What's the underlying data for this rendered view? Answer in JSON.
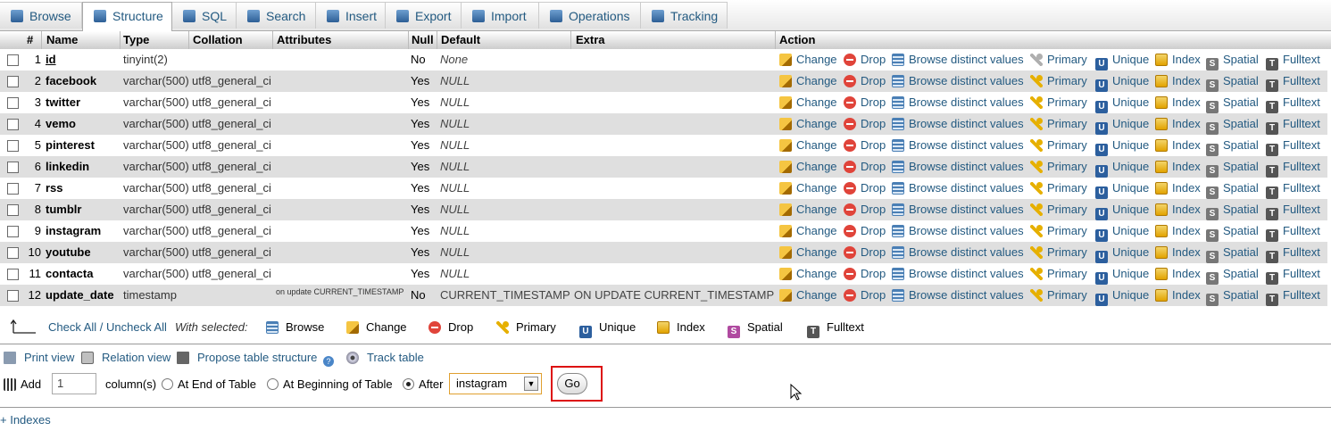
{
  "tabs": [
    {
      "label": "Browse",
      "icon": "browse-icon"
    },
    {
      "label": "Structure",
      "icon": "structure-icon"
    },
    {
      "label": "SQL",
      "icon": "sql-icon"
    },
    {
      "label": "Search",
      "icon": "search-icon"
    },
    {
      "label": "Insert",
      "icon": "insert-icon"
    },
    {
      "label": "Export",
      "icon": "export-icon"
    },
    {
      "label": "Import",
      "icon": "import-icon"
    },
    {
      "label": "Operations",
      "icon": "wrench-icon"
    },
    {
      "label": "Tracking",
      "icon": "eye-icon"
    }
  ],
  "active_tab": "Structure",
  "columns": {
    "num": "#",
    "name": "Name",
    "type": "Type",
    "collation": "Collation",
    "attributes": "Attributes",
    "null": "Null",
    "default": "Default",
    "extra": "Extra",
    "action": "Action"
  },
  "rows": [
    {
      "num": "1",
      "name": "id",
      "type": "tinyint(2)",
      "collation": "",
      "attributes": "",
      "null": "No",
      "default": "None",
      "extra": ""
    },
    {
      "num": "2",
      "name": "facebook",
      "type": "varchar(500)",
      "collation": "utf8_general_ci",
      "attributes": "",
      "null": "Yes",
      "default": "NULL",
      "extra": ""
    },
    {
      "num": "3",
      "name": "twitter",
      "type": "varchar(500)",
      "collation": "utf8_general_ci",
      "attributes": "",
      "null": "Yes",
      "default": "NULL",
      "extra": ""
    },
    {
      "num": "4",
      "name": "vemo",
      "type": "varchar(500)",
      "collation": "utf8_general_ci",
      "attributes": "",
      "null": "Yes",
      "default": "NULL",
      "extra": ""
    },
    {
      "num": "5",
      "name": "pinterest",
      "type": "varchar(500)",
      "collation": "utf8_general_ci",
      "attributes": "",
      "null": "Yes",
      "default": "NULL",
      "extra": ""
    },
    {
      "num": "6",
      "name": "linkedin",
      "type": "varchar(500)",
      "collation": "utf8_general_ci",
      "attributes": "",
      "null": "Yes",
      "default": "NULL",
      "extra": ""
    },
    {
      "num": "7",
      "name": "rss",
      "type": "varchar(500)",
      "collation": "utf8_general_ci",
      "attributes": "",
      "null": "Yes",
      "default": "NULL",
      "extra": ""
    },
    {
      "num": "8",
      "name": "tumblr",
      "type": "varchar(500)",
      "collation": "utf8_general_ci",
      "attributes": "",
      "null": "Yes",
      "default": "NULL",
      "extra": ""
    },
    {
      "num": "9",
      "name": "instagram",
      "type": "varchar(500)",
      "collation": "utf8_general_ci",
      "attributes": "",
      "null": "Yes",
      "default": "NULL",
      "extra": ""
    },
    {
      "num": "10",
      "name": "youtube",
      "type": "varchar(500)",
      "collation": "utf8_general_ci",
      "attributes": "",
      "null": "Yes",
      "default": "NULL",
      "extra": ""
    },
    {
      "num": "11",
      "name": "contacta",
      "type": "varchar(500)",
      "collation": "utf8_general_ci",
      "attributes": "",
      "null": "Yes",
      "default": "NULL",
      "extra": ""
    },
    {
      "num": "12",
      "name": "update_date",
      "type": "timestamp",
      "collation": "",
      "attributes": "on update CURRENT_TIMESTAMP",
      "null": "No",
      "default": "CURRENT_TIMESTAMP",
      "extra": "ON UPDATE CURRENT_TIMESTAMP"
    }
  ],
  "row_actions": {
    "change": "Change",
    "drop": "Drop",
    "browse_distinct": "Browse distinct values",
    "primary": "Primary",
    "unique": "Unique",
    "index": "Index",
    "spatial": "Spatial",
    "fulltext": "Fulltext"
  },
  "bulk": {
    "check_all": "Check All / Uncheck All",
    "with_selected": "With selected:",
    "browse": "Browse",
    "change": "Change",
    "drop": "Drop",
    "primary": "Primary",
    "unique": "Unique",
    "index": "Index",
    "spatial": "Spatial",
    "fulltext": "Fulltext"
  },
  "links": {
    "print_view": "Print view",
    "relation_view": "Relation view",
    "propose": "Propose table structure",
    "track": "Track table"
  },
  "add_column": {
    "label": "Add",
    "count": "1",
    "columns_label": "column(s)",
    "at_end": "At End of Table",
    "at_beginning": "At Beginning of Table",
    "after": "After",
    "after_selected": "instagram",
    "go": "Go"
  },
  "indexes_link": "+ Indexes"
}
